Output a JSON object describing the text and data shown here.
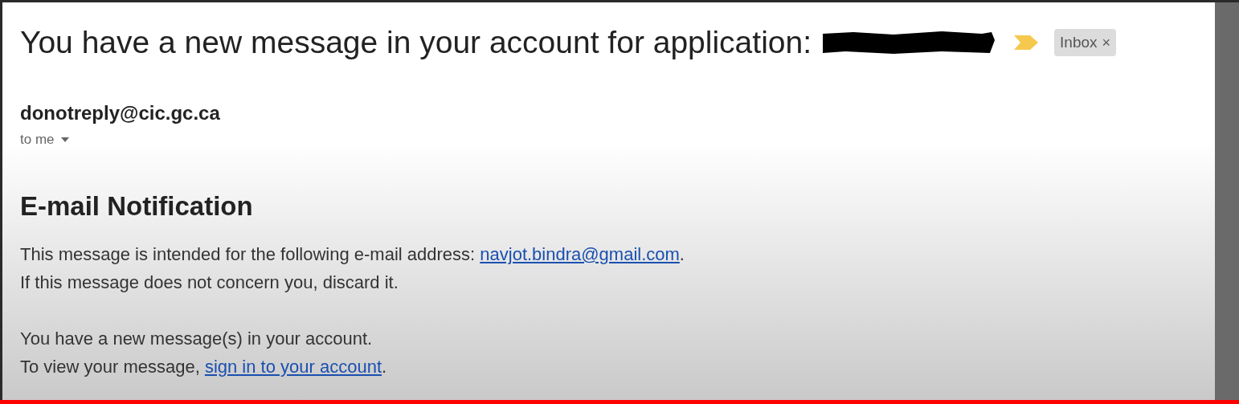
{
  "subject": "You have a new message in your account for application:",
  "label": {
    "text": "Inbox",
    "remove": "×"
  },
  "sender": "donotreply@cic.gc.ca",
  "recipient": "to me",
  "heading": "E-mail Notification",
  "paragraphs": [
    [
      {
        "before": "This message is intended for the following e-mail address: ",
        "link": "navjot.bindra@gmail.com",
        "after": "."
      },
      {
        "before": "If this message does not concern you, discard it."
      }
    ],
    [
      {
        "before": "You have a new message(s) in your account."
      },
      {
        "before": "To view your message, ",
        "link": "sign in to your account",
        "after": "."
      }
    ]
  ]
}
